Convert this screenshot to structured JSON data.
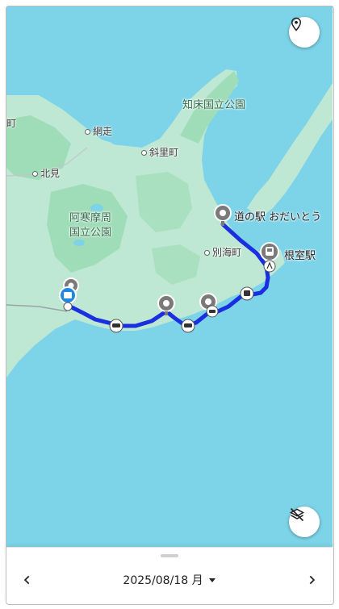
{
  "map": {
    "labels": {
      "shiretoko_park": "知床国立公園",
      "abashiri": "網走",
      "shari": "斜里町",
      "kitami": "北見",
      "akan_park_line1": "阿寒摩周",
      "akan_park_line2": "国立公園",
      "betsukai": "別海町",
      "michinoeki": "道の駅 おだいとう",
      "nemuro": "根室駅",
      "edge_town": "町"
    }
  },
  "footer": {
    "date": "2025/08/18 月"
  },
  "icons": {
    "locate": "location-pin-icon",
    "layers_off": "layers-off-icon",
    "prev": "chevron-left-icon",
    "next": "chevron-right-icon",
    "dropdown": "caret-down-icon"
  },
  "colors": {
    "sea": "#7dd4e8",
    "land": "#bfe8d4",
    "forest": "#9fdcb8",
    "route": "#1a2fe0",
    "accent": "#1e88e5"
  }
}
